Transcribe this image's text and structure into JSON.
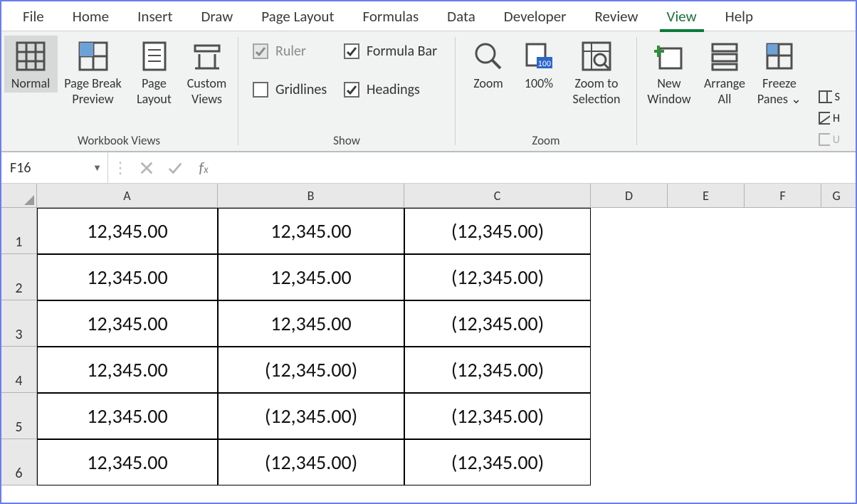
{
  "tabs": [
    "File",
    "Home",
    "Insert",
    "Draw",
    "Page Layout",
    "Formulas",
    "Data",
    "Developer",
    "Review",
    "View",
    "Help"
  ],
  "active_tab": "View",
  "ribbon": {
    "workbook_views": {
      "label": "Workbook Views",
      "normal": "Normal",
      "page_break": "Page Break Preview",
      "page_layout": "Page Layout",
      "custom_views": "Custom Views"
    },
    "show": {
      "label": "Show",
      "ruler": {
        "label": "Ruler",
        "checked": true,
        "disabled": true
      },
      "gridlines": {
        "label": "Gridlines",
        "checked": false,
        "disabled": false
      },
      "formula_bar": {
        "label": "Formula Bar",
        "checked": true,
        "disabled": false
      },
      "headings": {
        "label": "Headings",
        "checked": true,
        "disabled": false
      }
    },
    "zoom": {
      "label": "Zoom",
      "zoom": "Zoom",
      "hundred": "100%",
      "to_selection": "Zoom to Selection"
    },
    "window": {
      "new_window": "New Window",
      "arrange_all": "Arrange All",
      "freeze_panes": "Freeze Panes ⌄"
    },
    "extras": {
      "s": "S",
      "h": "H",
      "u": "U"
    }
  },
  "namebox": "F16",
  "formula": "",
  "columns": [
    "A",
    "B",
    "C",
    "D",
    "E",
    "F",
    "G"
  ],
  "rows": [
    "1",
    "2",
    "3",
    "4",
    "5",
    "6"
  ],
  "cells": {
    "A": [
      "12,345.00",
      "12,345.00",
      "12,345.00",
      "12,345.00",
      "12,345.00",
      "12,345.00"
    ],
    "B": [
      "12,345.00",
      "12,345.00",
      "12,345.00",
      "(12,345.00)",
      "(12,345.00)",
      "(12,345.00)"
    ],
    "C": [
      "(12,345.00)",
      "(12,345.00)",
      "(12,345.00)",
      "(12,345.00)",
      "(12,345.00)",
      "(12,345.00)"
    ]
  }
}
